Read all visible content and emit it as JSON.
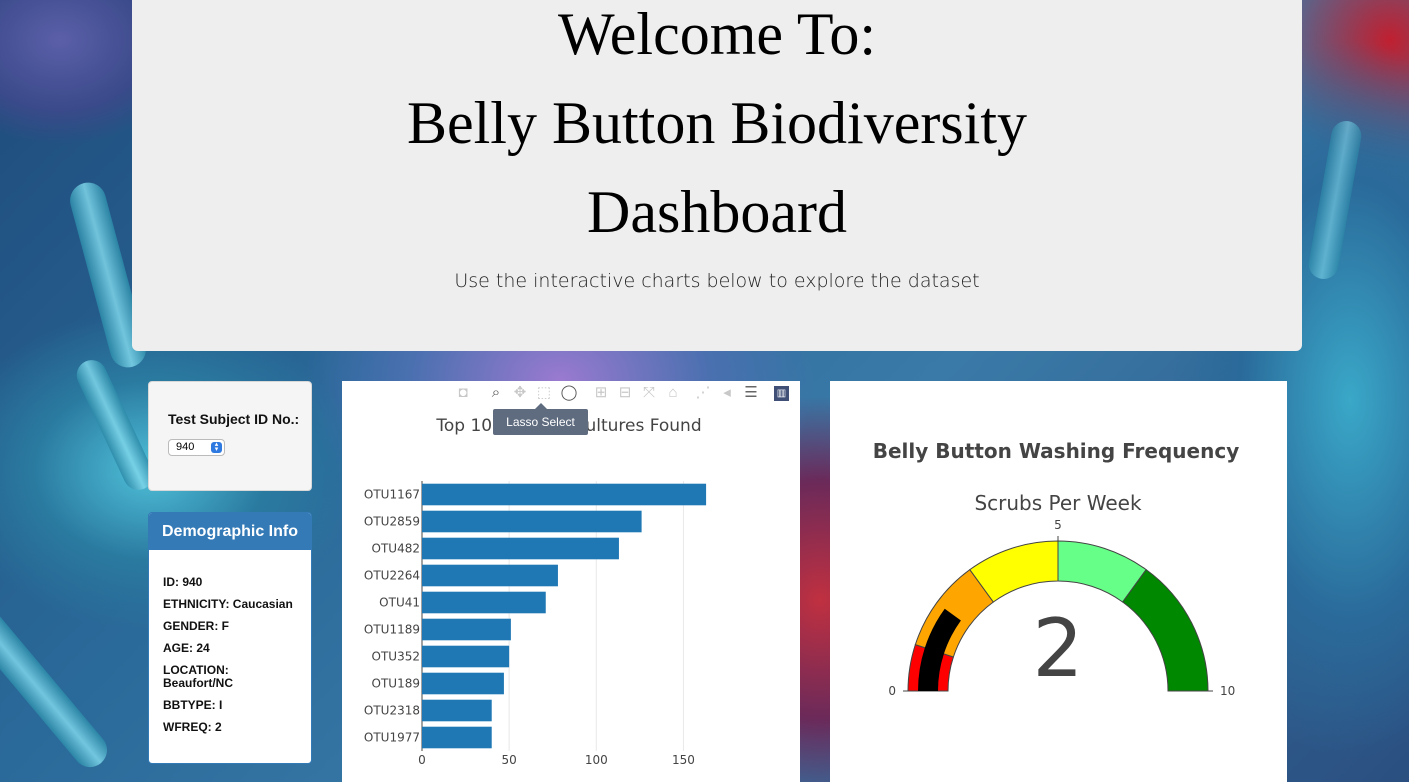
{
  "header": {
    "line1": "Welcome To:",
    "line2": "Belly Button Biodiversity",
    "line3": "Dashboard",
    "subtitle": "Use the interactive charts below to explore the dataset"
  },
  "selector": {
    "label": "Test Subject ID No.:",
    "value": "940"
  },
  "demographics": {
    "title": "Demographic Info",
    "rows": [
      "ID: 940",
      "ETHNICITY: Caucasian",
      "GENDER: F",
      "AGE: 24",
      "LOCATION: Beaufort/NC",
      "BBTYPE: I",
      "WFREQ: 2"
    ]
  },
  "modebar": {
    "icons": [
      "camera-icon",
      "zoom-icon",
      "pan-icon",
      "box-select-icon",
      "lasso-icon",
      "zoom-in-icon",
      "zoom-out-icon",
      "autoscale-icon",
      "home-icon",
      "spike-lines-icon",
      "hover-closest-icon",
      "hover-compare-icon",
      "plotly-logo-icon"
    ],
    "tooltip": "Lasso Select"
  },
  "chart_data": [
    {
      "type": "bar",
      "orientation": "horizontal",
      "title": "Top 10 Bacteria Cultures Found",
      "categories": [
        "OTU1167",
        "OTU2859",
        "OTU482",
        "OTU2264",
        "OTU41",
        "OTU1189",
        "OTU352",
        "OTU189",
        "OTU2318",
        "OTU1977"
      ],
      "values": [
        163,
        126,
        113,
        78,
        71,
        51,
        50,
        47,
        40,
        40
      ],
      "xlim": [
        0,
        175
      ],
      "xticks": [
        0,
        50,
        100,
        150
      ],
      "color": "#1f77b4",
      "grid": true
    },
    {
      "type": "gauge",
      "title": "Belly Button Washing Frequency",
      "subtitle": "Scrubs Per Week",
      "value": 2,
      "range": [
        0,
        10
      ],
      "ticks": [
        0,
        5,
        10
      ],
      "bands": [
        {
          "from": 0,
          "to": 1,
          "color": "#ff0000"
        },
        {
          "from": 1,
          "to": 3,
          "color": "#ffa500"
        },
        {
          "from": 3,
          "to": 5,
          "color": "#ffff00"
        },
        {
          "from": 5,
          "to": 7,
          "color": "#66ff88"
        },
        {
          "from": 7,
          "to": 10,
          "color": "#008800"
        }
      ],
      "bar_color": "#000000"
    }
  ]
}
